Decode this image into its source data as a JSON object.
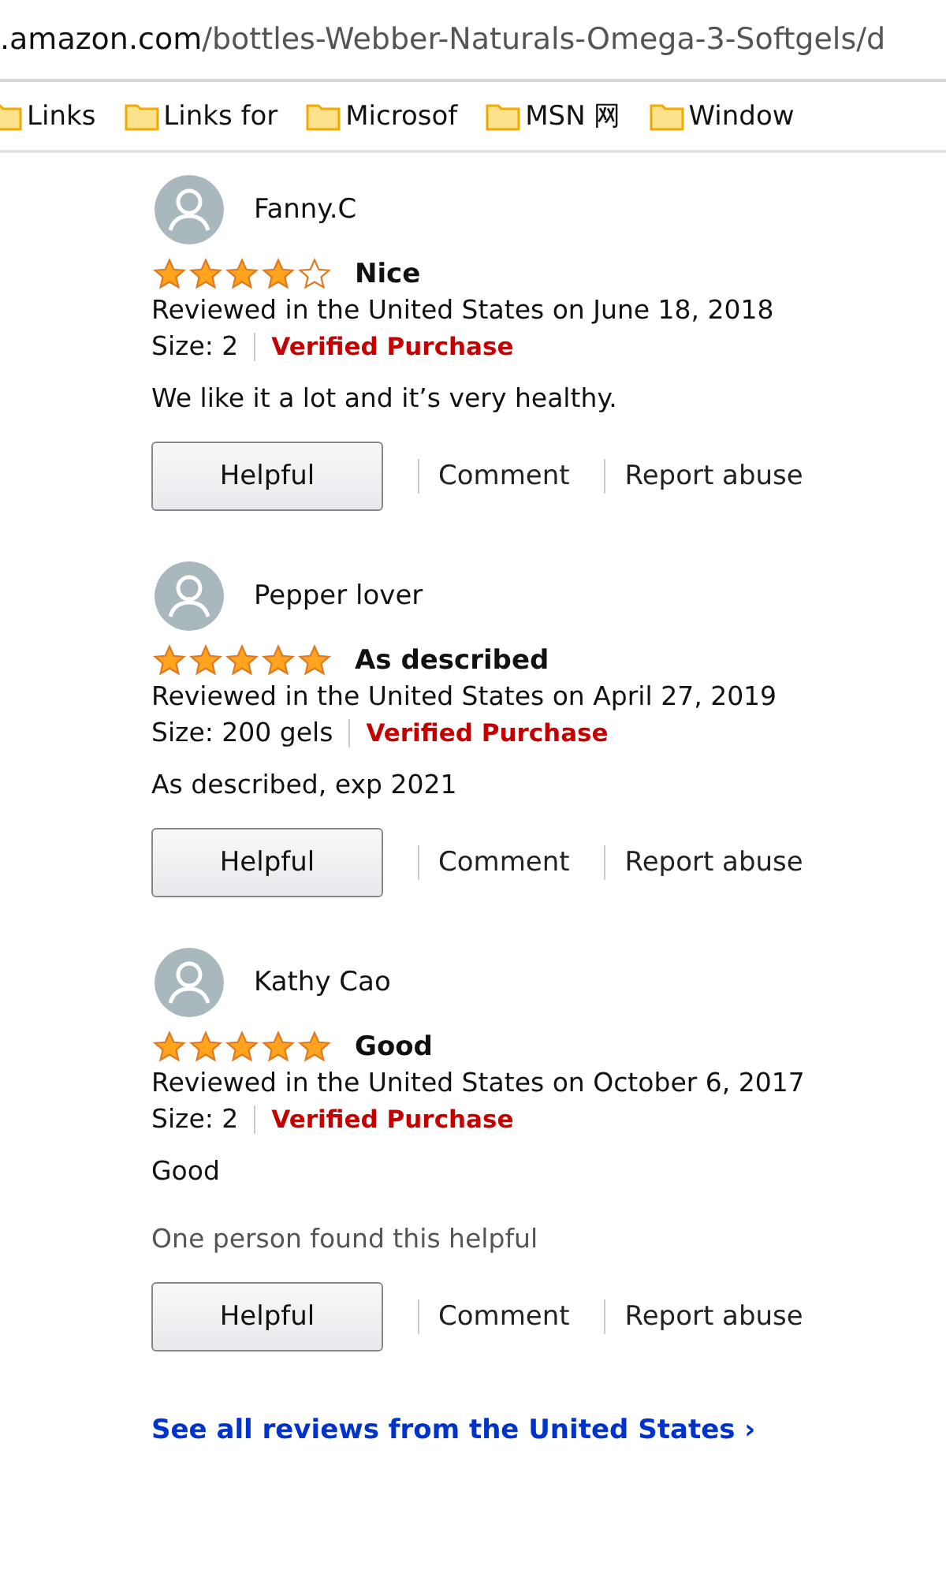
{
  "address_bar": {
    "host": ".amazon.com",
    "path": "/bottles-Webber-Naturals-Omega-3-Softgels/d"
  },
  "bookmarks": [
    {
      "label": "Links"
    },
    {
      "label": "Links for"
    },
    {
      "label": "Microsof"
    },
    {
      "label": "MSN 网"
    },
    {
      "label": "Window"
    }
  ],
  "reviews": [
    {
      "author": "Fanny.C",
      "stars": 4,
      "title": "Nice",
      "date": "Reviewed in the United States on June 18, 2018",
      "size": "Size: 2",
      "badge": "Verified Purchase",
      "body": "We like it a lot and it’s very healthy.",
      "actions": [
        "Helpful",
        "Comment",
        "Report abuse"
      ]
    },
    {
      "author": "Pepper lover",
      "stars": 5,
      "title": "As described",
      "date": "Reviewed in the United States on April 27, 2019",
      "size": "Size: 200 gels",
      "badge": "Verified Purchase",
      "body": "As described, exp 2021",
      "actions": [
        "Helpful",
        "Comment",
        "Report abuse"
      ]
    },
    {
      "author": "Kathy Cao",
      "stars": 5,
      "title": "Good",
      "date": "Reviewed in the United States on October 6, 2017",
      "size": "Size: 2",
      "badge": "Verified Purchase",
      "body": "Good",
      "helpful_count": "One person found this helpful",
      "actions": [
        "Helpful",
        "Comment",
        "Report abuse"
      ]
    }
  ],
  "see_all_link": "See all reviews from the United States ›"
}
